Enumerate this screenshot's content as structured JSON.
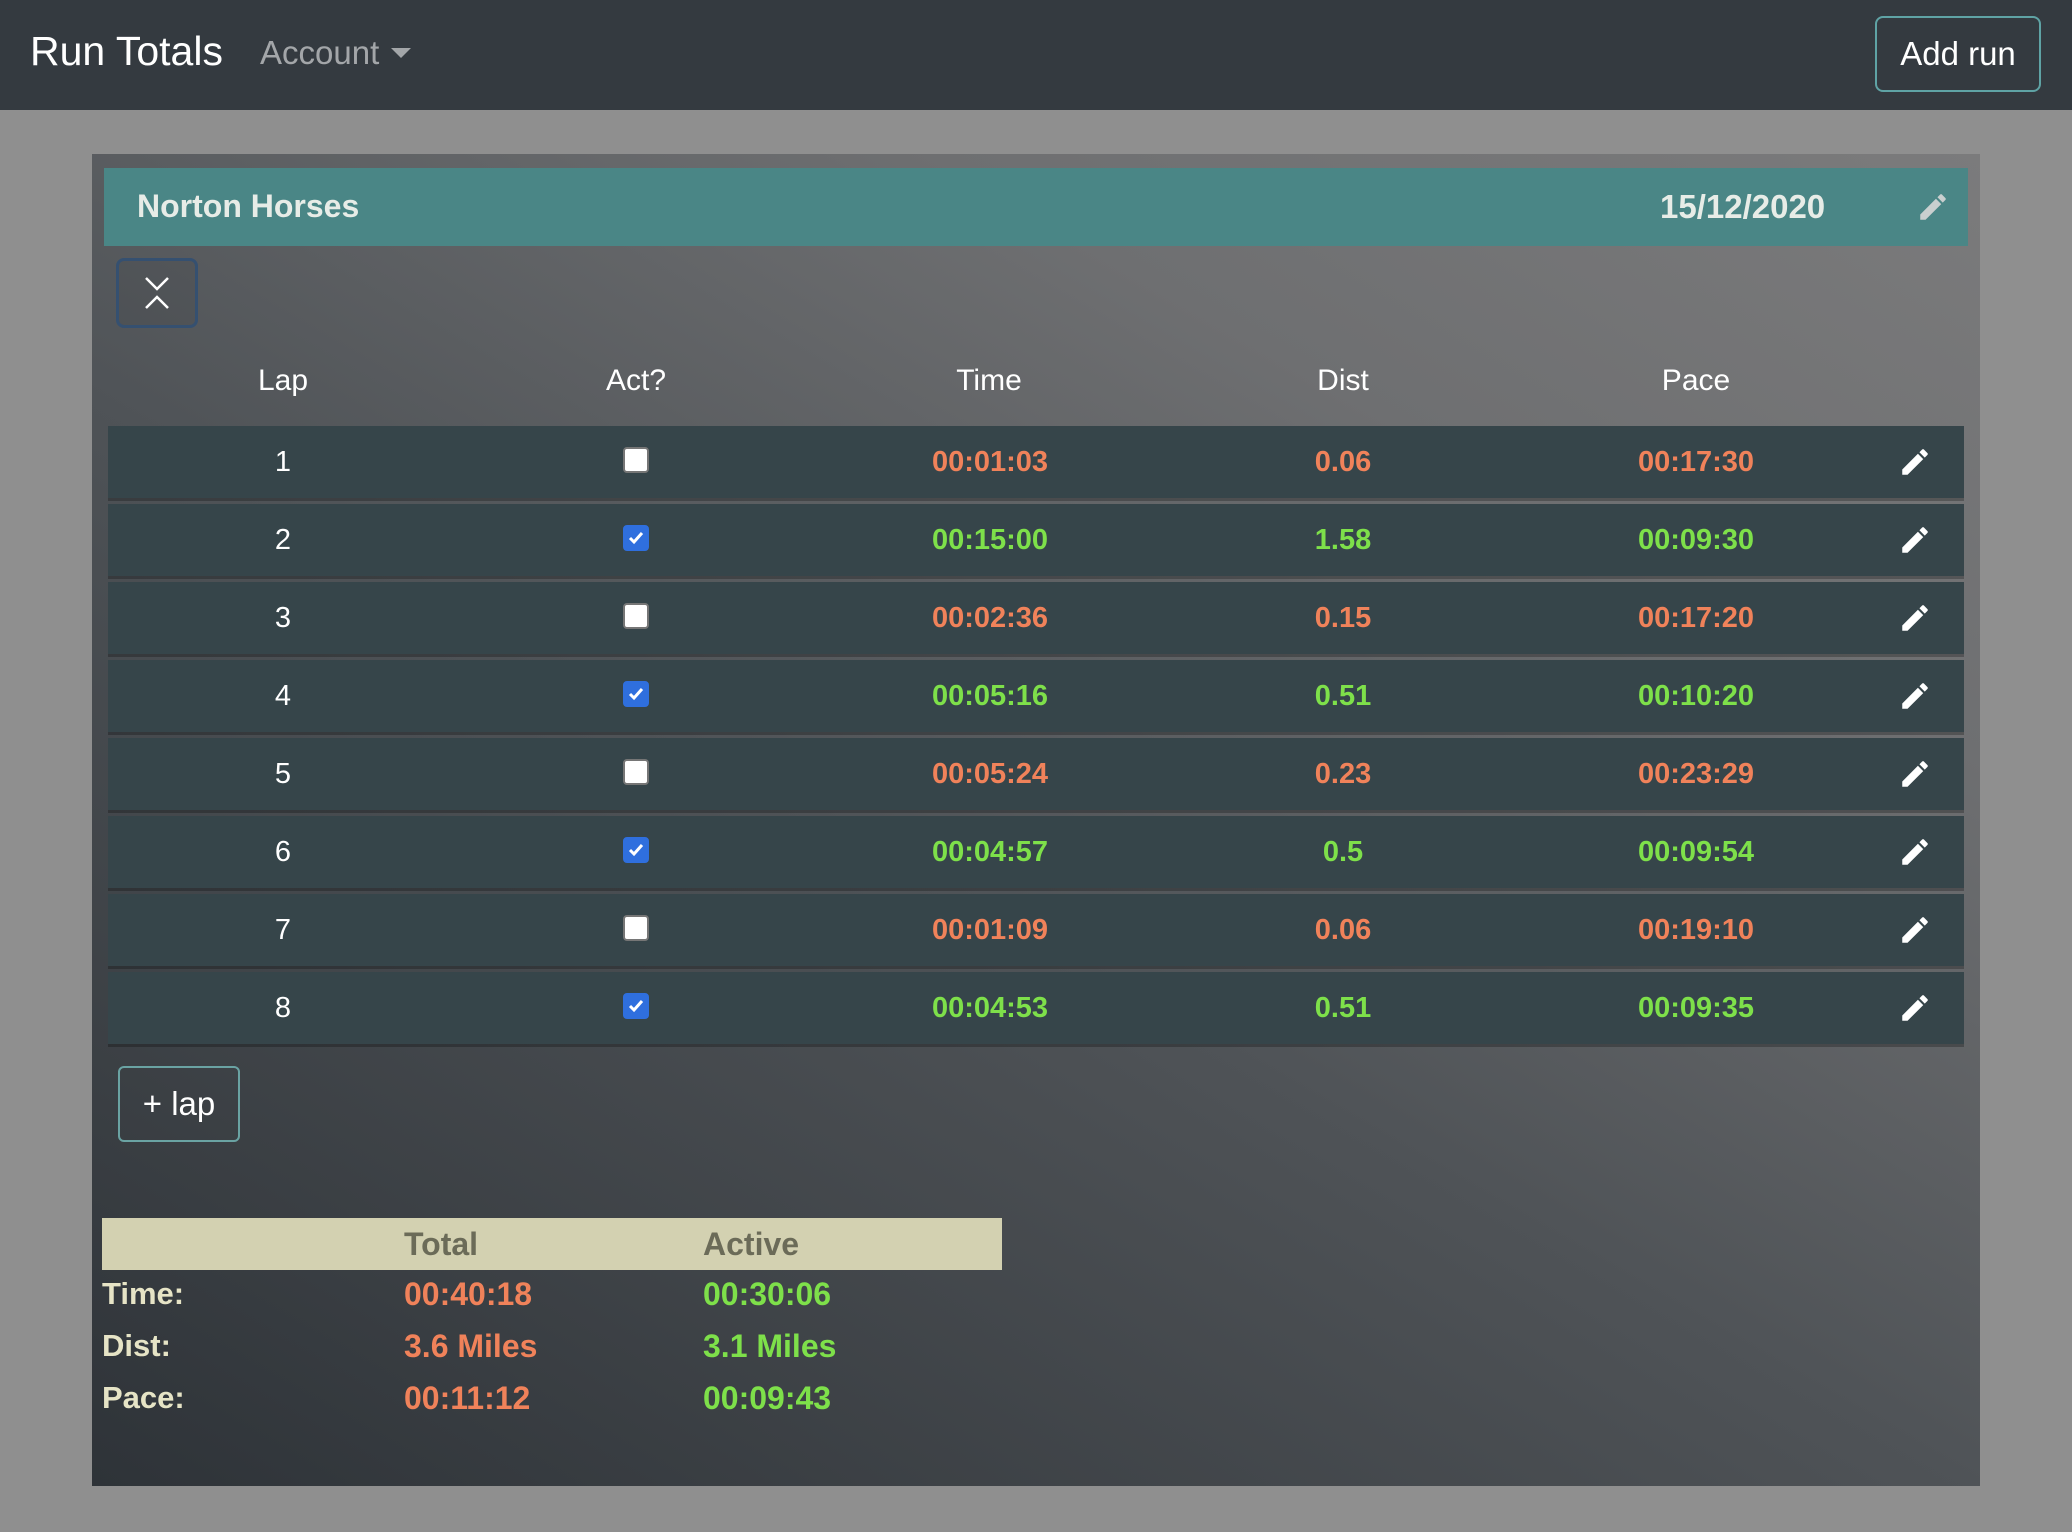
{
  "navbar": {
    "brand": "Run Totals",
    "account_label": "Account",
    "add_run_label": "Add run"
  },
  "run": {
    "name": "Norton Horses",
    "date": "15/12/2020"
  },
  "columns": [
    "Lap",
    "Act?",
    "Time",
    "Dist",
    "Pace"
  ],
  "laps": [
    {
      "lap": "1",
      "active": false,
      "time": "00:01:03",
      "dist": "0.06",
      "pace": "00:17:30"
    },
    {
      "lap": "2",
      "active": true,
      "time": "00:15:00",
      "dist": "1.58",
      "pace": "00:09:30"
    },
    {
      "lap": "3",
      "active": false,
      "time": "00:02:36",
      "dist": "0.15",
      "pace": "00:17:20"
    },
    {
      "lap": "4",
      "active": true,
      "time": "00:05:16",
      "dist": "0.51",
      "pace": "00:10:20"
    },
    {
      "lap": "5",
      "active": false,
      "time": "00:05:24",
      "dist": "0.23",
      "pace": "00:23:29"
    },
    {
      "lap": "6",
      "active": true,
      "time": "00:04:57",
      "dist": "0.5",
      "pace": "00:09:54"
    },
    {
      "lap": "7",
      "active": false,
      "time": "00:01:09",
      "dist": "0.06",
      "pace": "00:19:10"
    },
    {
      "lap": "8",
      "active": true,
      "time": "00:04:53",
      "dist": "0.51",
      "pace": "00:09:35"
    }
  ],
  "add_lap_label": "+ lap",
  "summary": {
    "headers": {
      "total": "Total",
      "active": "Active"
    },
    "rows": [
      {
        "label": "Time:",
        "total": "00:40:18",
        "active": "00:30:06"
      },
      {
        "label": "Dist:",
        "total": "3.6 Miles",
        "active": "3.1 Miles"
      },
      {
        "label": "Pace:",
        "total": "00:11:12",
        "active": "00:09:43"
      }
    ]
  },
  "colors": {
    "active_value": "#7ee04a",
    "inactive_value": "#f0825a",
    "header_bar": "#4a8686",
    "summary_header": "#d3d1b1"
  },
  "icons": {
    "edit": "pencil-icon",
    "collapse": "collapse-chevrons-icon",
    "account_menu": "caret-down-icon"
  }
}
